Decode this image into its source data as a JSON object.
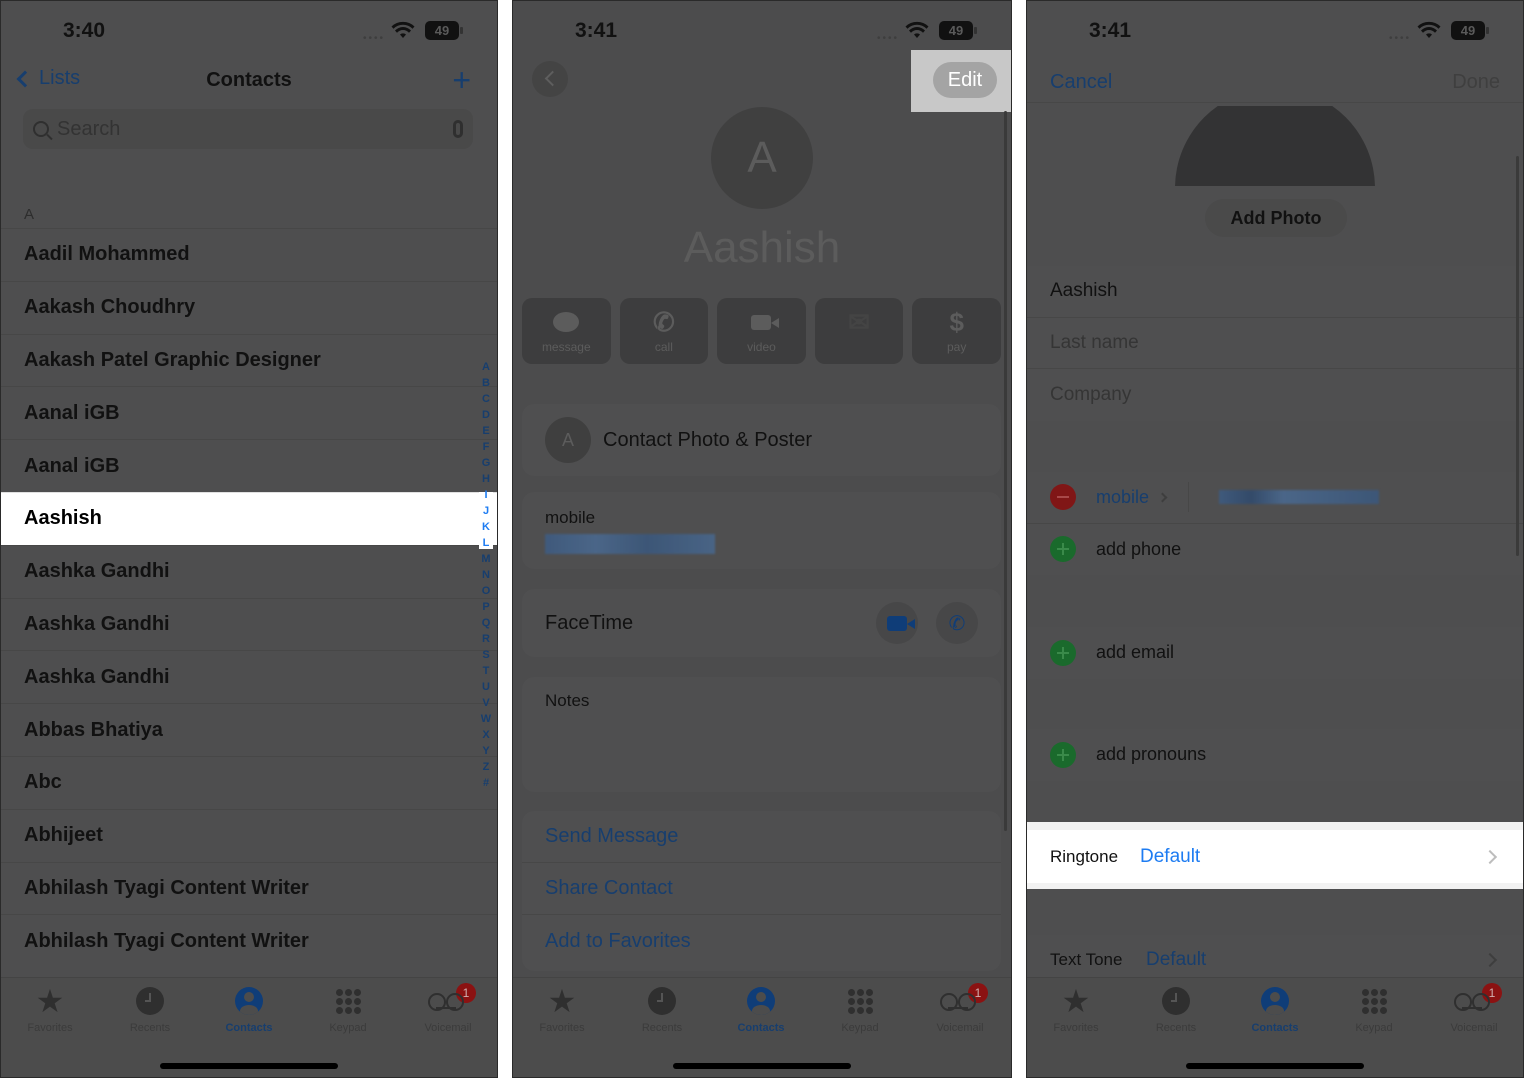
{
  "panel1": {
    "status": {
      "time": "3:40",
      "battery": "49"
    },
    "nav": {
      "back_label": "Lists",
      "title": "Contacts",
      "add_label": "+"
    },
    "search": {
      "placeholder": "Search"
    },
    "section_letter": "A",
    "contacts": [
      {
        "name": "Aadil Mohammed",
        "highlighted": false
      },
      {
        "name": "Aakash Choudhry",
        "highlighted": false
      },
      {
        "name": "Aakash Patel Graphic Designer",
        "highlighted": false
      },
      {
        "name": "Aanal iGB",
        "highlighted": false
      },
      {
        "name": "Aanal iGB",
        "highlighted": false
      },
      {
        "name": "Aashish",
        "highlighted": true
      },
      {
        "name": "Aashka Gandhi",
        "highlighted": false
      },
      {
        "name": "Aashka Gandhi",
        "highlighted": false
      },
      {
        "name": "Aashka Gandhi",
        "highlighted": false
      },
      {
        "name": "Abbas Bhatiya",
        "highlighted": false
      },
      {
        "name": "Abc",
        "highlighted": false
      },
      {
        "name": "Abhijeet",
        "highlighted": false
      },
      {
        "name": "Abhilash Tyagi Content Writer",
        "highlighted": false
      },
      {
        "name": "Abhilash Tyagi Content Writer",
        "highlighted": false
      }
    ],
    "index_letters": [
      "A",
      "B",
      "C",
      "D",
      "E",
      "F",
      "G",
      "H",
      "I",
      "J",
      "K",
      "L",
      "M",
      "N",
      "O",
      "P",
      "Q",
      "R",
      "S",
      "T",
      "U",
      "V",
      "W",
      "X",
      "Y",
      "Z",
      "#"
    ],
    "index_highlighted": [
      "I",
      "J",
      "K",
      "L"
    ]
  },
  "panel2": {
    "status": {
      "time": "3:41",
      "battery": "49"
    },
    "edit_label": "Edit",
    "avatar_initial": "A",
    "contact_name": "Aashish",
    "actions": [
      {
        "icon": "message-icon",
        "label": "message"
      },
      {
        "icon": "phone-icon",
        "label": "call"
      },
      {
        "icon": "video-icon",
        "label": "video"
      },
      {
        "icon": "mail-icon",
        "label": ""
      },
      {
        "icon": "dollar-icon",
        "label": "pay"
      }
    ],
    "photo_row": {
      "initial": "A",
      "label": "Contact Photo & Poster"
    },
    "mobile_label": "mobile",
    "facetime_label": "FaceTime",
    "notes_label": "Notes",
    "links": [
      "Send Message",
      "Share Contact",
      "Add to Favorites"
    ]
  },
  "panel3": {
    "status": {
      "time": "3:41",
      "battery": "49"
    },
    "cancel_label": "Cancel",
    "done_label": "Done",
    "add_photo_label": "Add Photo",
    "first_name_value": "Aashish",
    "last_name_placeholder": "Last name",
    "company_placeholder": "Company",
    "phone_type_label": "mobile",
    "add_phone_label": "add phone",
    "add_email_label": "add email",
    "add_pronouns_label": "add pronouns",
    "ringtone": {
      "label": "Ringtone",
      "value": "Default"
    },
    "text_tone": {
      "label": "Text Tone",
      "value": "Default"
    }
  },
  "tabbar": {
    "tabs": [
      {
        "label": "Favorites",
        "icon": "star-icon",
        "active": false
      },
      {
        "label": "Recents",
        "icon": "clock-icon",
        "active": false
      },
      {
        "label": "Contacts",
        "icon": "person-icon",
        "active": true
      },
      {
        "label": "Keypad",
        "icon": "keypad-icon",
        "active": false
      },
      {
        "label": "Voicemail",
        "icon": "voicemail-icon",
        "active": false
      }
    ],
    "voicemail_badge": "1"
  },
  "colors": {
    "ios_blue": "#1e7cf2",
    "dimmed_blue": "#173e6e",
    "delete_red": "#801616",
    "add_green": "#1a6a2c",
    "badge_red": "#8b1212",
    "overlay_gray": "#4e4e4f",
    "highlight_white": "#ffffff"
  }
}
